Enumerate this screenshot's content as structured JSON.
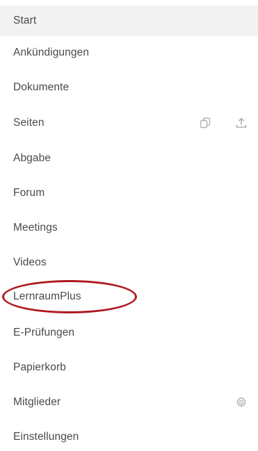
{
  "nav": {
    "items": [
      {
        "label": "Start",
        "active": true
      },
      {
        "label": "Ankündigungen"
      },
      {
        "label": "Dokumente"
      },
      {
        "label": "Seiten",
        "icons": [
          "copy-icon",
          "upload-icon"
        ]
      },
      {
        "label": "Abgabe"
      },
      {
        "label": "Forum"
      },
      {
        "label": "Meetings"
      },
      {
        "label": "Videos"
      },
      {
        "label": "LernraumPlus",
        "highlighted": true
      },
      {
        "label": "E-Prüfungen"
      },
      {
        "label": "Papierkorb"
      },
      {
        "label": "Mitglieder",
        "icons": [
          "gear-icon"
        ]
      },
      {
        "label": "Einstellungen"
      }
    ]
  },
  "colors": {
    "active_background": "#f2f2f2",
    "text": "#4a4a4a",
    "icon": "#b0b0b0",
    "highlight_ring": "#b01820"
  }
}
